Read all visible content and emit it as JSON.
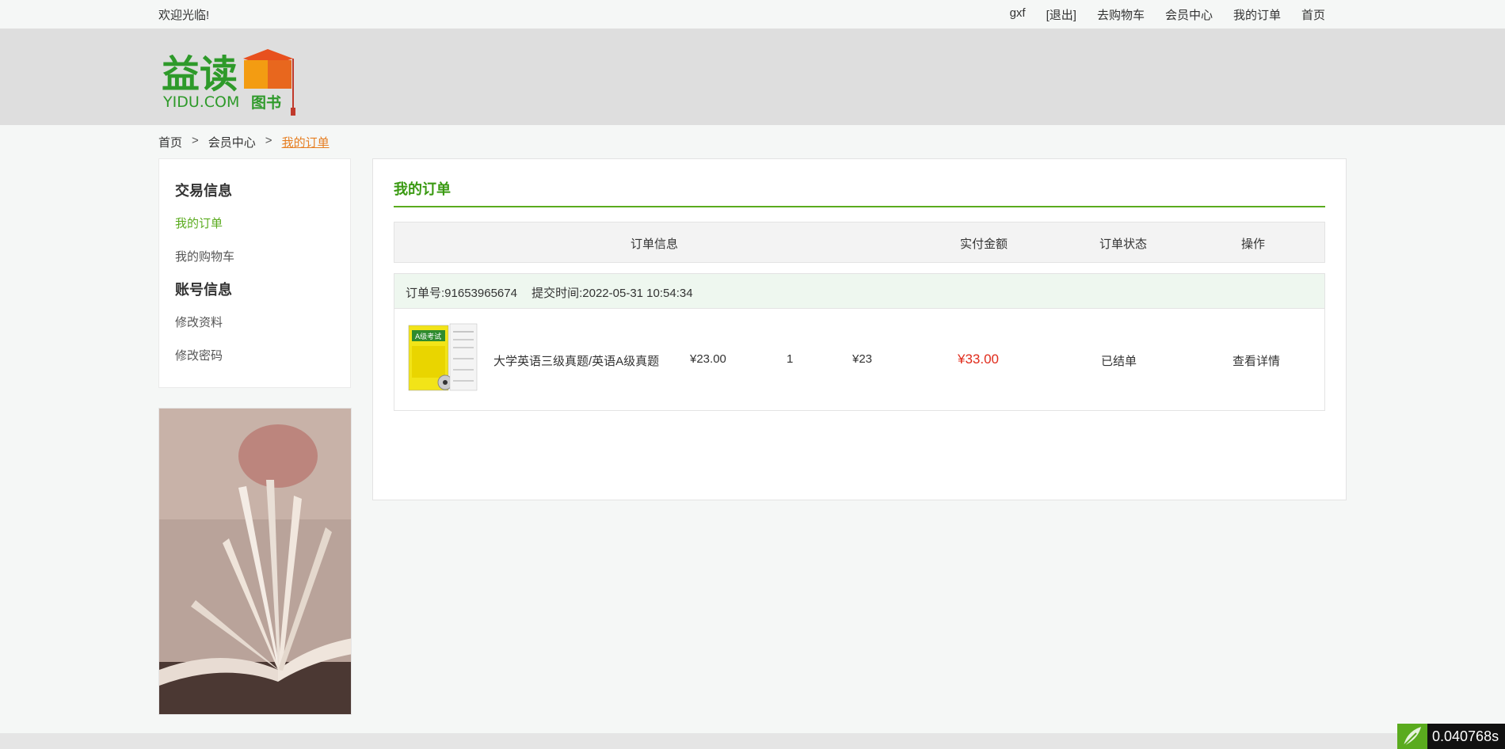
{
  "topbar": {
    "welcome": "欢迎光临!",
    "username": "gxf",
    "logout": "[退出]",
    "cart": "去购物车",
    "member": "会员中心",
    "orders": "我的订单",
    "home": "首页"
  },
  "logo": {
    "main": "益读",
    "sub": "YIDU.COM",
    "tag": "图书"
  },
  "breadcrumb": {
    "home": "首页",
    "sep": ">",
    "member": "会员中心",
    "current": "我的订单"
  },
  "sidebar": {
    "group1": {
      "title": "交易信息",
      "items": [
        "我的订单",
        "我的购物车"
      ]
    },
    "group2": {
      "title": "账号信息",
      "items": [
        "修改资料",
        "修改密码"
      ]
    }
  },
  "main": {
    "title": "我的订单",
    "columns": [
      "订单信息",
      "实付金额",
      "订单状态",
      "操作"
    ]
  },
  "order": {
    "number_label": "订单号:91653965674",
    "time_label": "提交时间:2022-05-31 10:54:34",
    "book_title": "大学英语三级真题/英语A级真题",
    "unit_price": "¥23.00",
    "quantity": "1",
    "subtotal": "¥23",
    "paid": "¥33.00",
    "status": "已结单",
    "action": "查看详情",
    "cover_text": "A级考试"
  },
  "timer": {
    "value": "0.040768s"
  },
  "colors": {
    "accent_green": "#5aab1e",
    "price_red": "#e02a1a",
    "breadcrumb_orange": "#e67e22"
  }
}
